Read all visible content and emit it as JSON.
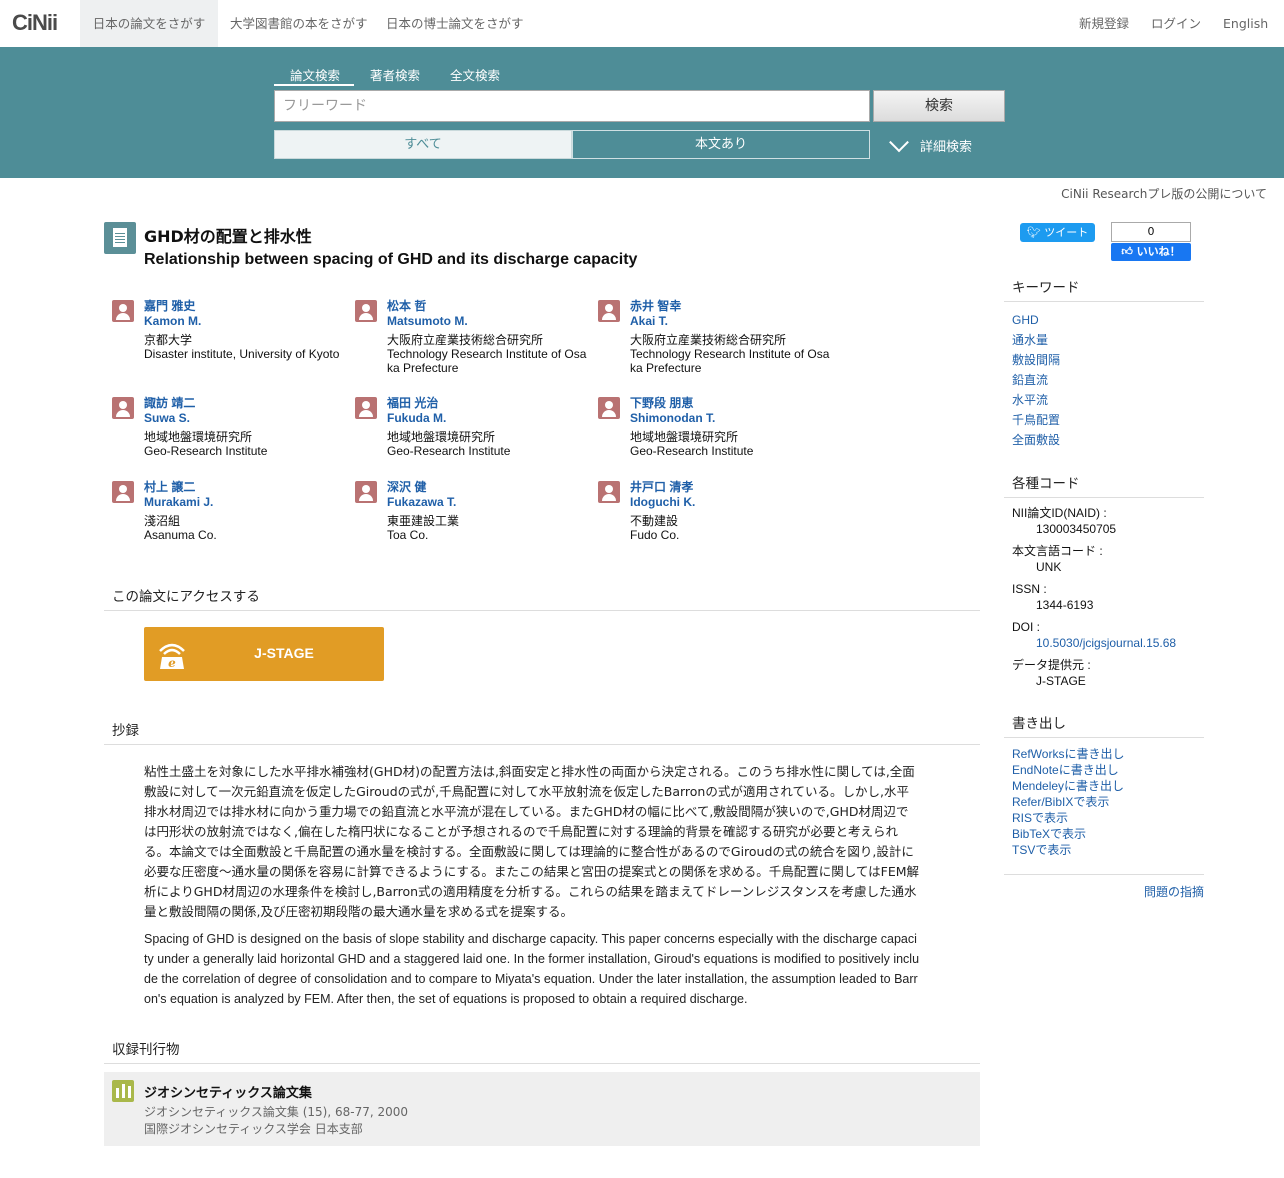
{
  "header": {
    "logo": "CiNii",
    "nav": [
      "日本の論文をさがす",
      "大学図書館の本をさがす",
      "日本の博士論文をさがす"
    ],
    "right_nav": [
      "新規登録",
      "ログイン",
      "English"
    ]
  },
  "search": {
    "tabs": [
      "論文検索",
      "著者検索",
      "全文検索"
    ],
    "placeholder": "フリーワード",
    "button": "検索",
    "filter_all": "すべて",
    "filter_fulltext": "本文あり",
    "advanced": "詳細検索"
  },
  "notice": "CiNii Researchプレ版の公開について",
  "article": {
    "title_ja": "GHD材の配置と排水性",
    "title_en": "Relationship between spacing of GHD and its discharge capacity"
  },
  "authors": [
    {
      "name_ja": "嘉門 雅史",
      "name_en": "Kamon M.",
      "aff_ja": "京都大学",
      "aff_en": "Disaster institute, University of Kyoto"
    },
    {
      "name_ja": "松本 哲",
      "name_en": "Matsumoto M.",
      "aff_ja": "大阪府立産業技術総合研究所",
      "aff_en": "Technology Research Institute of Osaka Prefecture"
    },
    {
      "name_ja": "赤井 智幸",
      "name_en": "Akai T.",
      "aff_ja": "大阪府立産業技術総合研究所",
      "aff_en": "Technology Research Institute of Osaka Prefecture"
    },
    {
      "name_ja": "諏訪 靖二",
      "name_en": "Suwa S.",
      "aff_ja": "地域地盤環境研究所",
      "aff_en": "Geo-Research Institute"
    },
    {
      "name_ja": "福田 光治",
      "name_en": "Fukuda M.",
      "aff_ja": "地域地盤環境研究所",
      "aff_en": "Geo-Research Institute"
    },
    {
      "name_ja": "下野段 朋恵",
      "name_en": "Shimonodan T.",
      "aff_ja": "地域地盤環境研究所",
      "aff_en": "Geo-Research Institute"
    },
    {
      "name_ja": "村上 譲二",
      "name_en": "Murakami J.",
      "aff_ja": "淺沼組",
      "aff_en": "Asanuma Co."
    },
    {
      "name_ja": "深沢 健",
      "name_en": "Fukazawa T.",
      "aff_ja": "東亜建設工業",
      "aff_en": "Toa Co."
    },
    {
      "name_ja": "井戸口 清孝",
      "name_en": "Idoguchi K.",
      "aff_ja": "不動建設",
      "aff_en": "Fudo Co."
    }
  ],
  "access": {
    "heading": "この論文にアクセスする",
    "button": "J-STAGE"
  },
  "abstract": {
    "heading": "抄録",
    "ja": "粘性土盛土を対象にした水平排水補強材(GHD材)の配置方法は,斜面安定と排水性の両面から決定される。このうち排水性に関しては,全面敷設に対して一次元鉛直流を仮定したGiroudの式が,千鳥配置に対して水平放射流を仮定したBarronの式が適用されている。しかし,水平排水材周辺では排水材に向かう重力場での鉛直流と水平流が混在している。またGHD材の幅に比べて,敷設間隔が狭いので,GHD材周辺では円形状の放射流ではなく,偏在した楕円状になることが予想されるので千鳥配置に対する理論的背景を確認する研究が必要と考えられる。本論文では全面敷設と千鳥配置の通水量を検討する。全面敷設に関しては理論的に整合性があるのでGiroudの式の統合を図り,設計に必要な圧密度～通水量の関係を容易に計算できるようにする。またこの結果と宮田の提案式との関係を求める。千鳥配置に関してはFEM解析によりGHD材周辺の水理条件を検討し,Barron式の適用精度を分析する。これらの結果を踏まえてドレーンレジスタンスを考慮した通水量と敷設間隔の関係,及び圧密初期段階の最大通水量を求める式を提案する。",
    "en": "Spacing of GHD is designed on the basis of slope stability and discharge capacity. This paper concerns especially with the discharge capacity under a generally laid horizontal GHD and a staggered laid one. In the former installation, Giroud's equations is modified to positively include the correlation of degree of consolidation and to compare to Miyata's equation. Under the later installation, the assumption leaded to Barron's equation is analyzed by FEM. After then, the set of equations is proposed to obtain a required discharge."
  },
  "journal": {
    "heading": "収録刊行物",
    "title": "ジオシンセティックス論文集",
    "volume": "ジオシンセティックス論文集 (15), 68-77, 2000",
    "publisher": "国際ジオシンセティックス学会 日本支部"
  },
  "sidebar": {
    "tweet": "ツイート",
    "like_count": "0",
    "like_label": "いいね！",
    "keywords_heading": "キーワード",
    "keywords": [
      "GHD",
      "通水量",
      "敷設間隔",
      "鉛直流",
      "水平流",
      "千鳥配置",
      "全面敷設"
    ],
    "codes_heading": "各種コード",
    "codes": {
      "naid_label": "NII論文ID(NAID) :",
      "naid": "130003450705",
      "lang_label": "本文言語コード :",
      "lang": "UNK",
      "issn_label": "ISSN :",
      "issn": "1344-6193",
      "doi_label": "DOI :",
      "doi": "10.5030/jcigsjournal.15.68",
      "provider_label": "データ提供元 :",
      "provider": "J-STAGE"
    },
    "export_heading": "書き出し",
    "export": [
      "RefWorksに書き出し",
      "EndNoteに書き出し",
      "Mendeleyに書き出し",
      "Refer/BibIXで表示",
      "RISで表示",
      "BibTeXで表示",
      "TSVで表示"
    ],
    "report": "問題の指摘"
  }
}
